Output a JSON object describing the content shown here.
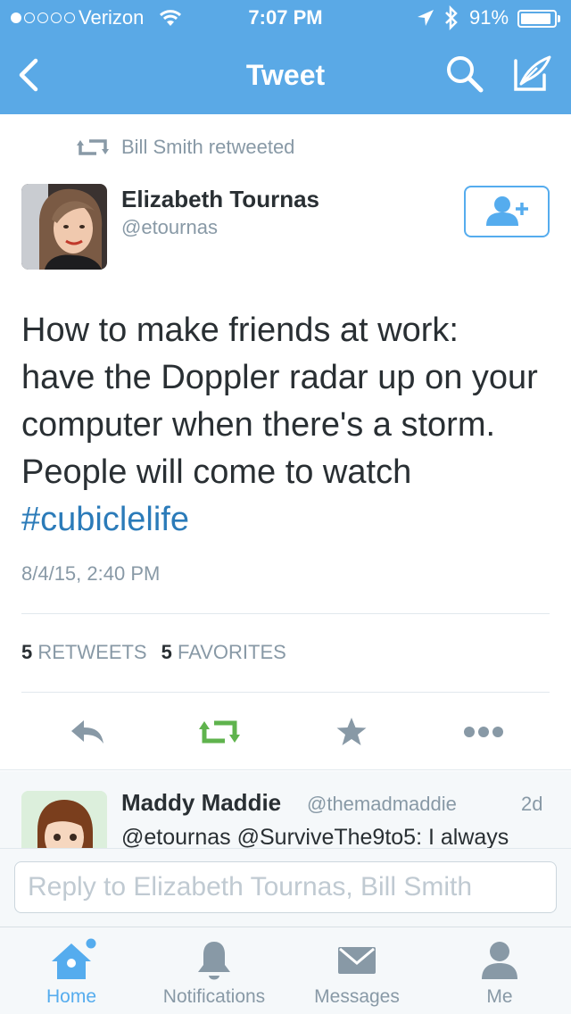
{
  "status_bar": {
    "carrier": "Verizon",
    "signal_bars": 1,
    "time": "7:07 PM",
    "battery_percent": "91%",
    "battery_level": 0.91,
    "icons": [
      "wifi-icon",
      "location-icon",
      "bluetooth-icon",
      "battery-icon"
    ]
  },
  "nav": {
    "title": "Tweet",
    "back_icon": "chevron-left-icon",
    "search_icon": "search-icon",
    "compose_icon": "compose-icon"
  },
  "colors": {
    "brand_blue": "#5aa9e6",
    "link_blue": "#2b7bb9",
    "retweet_green": "#5fb34d",
    "muted_gray": "#8899a6"
  },
  "tweet": {
    "retweeted_by": "Bill Smith retweeted",
    "author_name": "Elizabeth Tournas",
    "author_handle": "@etournas",
    "text_lines": [
      "How to make friends at work:",
      "have the Doppler radar up on your",
      "computer when there's a storm.",
      "People will come to watch"
    ],
    "hashtag": "#cubiclelife",
    "timestamp": "8/4/15, 2:40 PM",
    "retweets_count": "5",
    "retweets_label": "RETWEETS",
    "favorites_count": "5",
    "favorites_label": "FAVORITES",
    "action_icons": [
      "reply-icon",
      "retweet-icon",
      "favorite-icon",
      "more-icon"
    ]
  },
  "reply": {
    "name": "Maddy Maddie",
    "handle": "@themadmaddie",
    "time": "2d",
    "text": "@etournas @SurviveThe9to5: I always"
  },
  "composer": {
    "placeholder": "Reply to Elizabeth Tournas, Bill Smith",
    "value": ""
  },
  "tabbar": {
    "items": [
      {
        "label": "Home",
        "icon": "home-icon",
        "active": true,
        "has_badge": true
      },
      {
        "label": "Notifications",
        "icon": "bell-icon",
        "active": false
      },
      {
        "label": "Messages",
        "icon": "envelope-icon",
        "active": false
      },
      {
        "label": "Me",
        "icon": "person-icon",
        "active": false
      }
    ]
  }
}
